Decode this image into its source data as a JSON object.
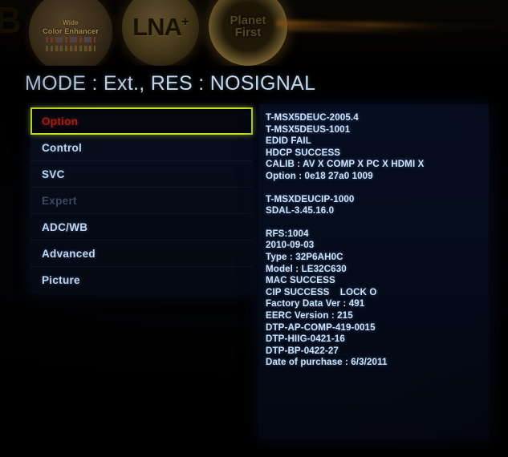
{
  "device": {
    "bezel_stickers": [
      {
        "id": "wide-color-enhancer",
        "line1": "Wide",
        "line2": "Color Enhancer"
      },
      {
        "id": "lna-plus",
        "text": "LN",
        "suffix": "A",
        "plus": "+"
      },
      {
        "id": "planet-first",
        "line1": "Planet",
        "line2": "First"
      }
    ],
    "bezel_partial_letter": "B"
  },
  "header": {
    "title": "MODE : Ext., RES : NOSIGNAL"
  },
  "menu": {
    "items": [
      {
        "label": "Option",
        "state": "selected"
      },
      {
        "label": "Control",
        "state": "normal"
      },
      {
        "label": "SVC",
        "state": "normal"
      },
      {
        "label": "Expert",
        "state": "disabled"
      },
      {
        "label": "ADC/WB",
        "state": "normal"
      },
      {
        "label": "Advanced",
        "state": "normal"
      },
      {
        "label": "Picture",
        "state": "normal"
      }
    ]
  },
  "info_panel": {
    "blocks": [
      {
        "lines": [
          "T-MSX5DEUC-2005.4",
          "T-MSX5DEUS-1001",
          "EDID FAIL",
          "HDCP SUCCESS",
          "CALIB : AV X COMP X PC X HDMI X",
          "Option : 0e18 27a0 1009"
        ]
      },
      {
        "lines": [
          "T-MSXDEUCIP-1000",
          "SDAL-3.45.16.0"
        ]
      },
      {
        "lines": [
          "RFS:1004",
          "2010-09-03",
          "Type : 32P6AH0C",
          "Model : LE32C630",
          "MAC SUCCESS",
          "CIP SUCCESS    LOCK O",
          "Factory Data Ver : 491",
          "EERC Version : 215",
          "DTP-AP-COMP-419-0015",
          "DTP-HIIG-0421-16",
          "DTP-BP-0422-27",
          "Date of purchase : 6/3/2011"
        ]
      }
    ]
  },
  "colors": {
    "selection_border": "#c8e02a",
    "selected_label": "#a22018",
    "menu_label": "#c3d6ea",
    "disabled_label": "#3d4a60",
    "info_text": "#cfe2f8",
    "panel_bg": "#060d20",
    "screen_bg": "#000000"
  }
}
